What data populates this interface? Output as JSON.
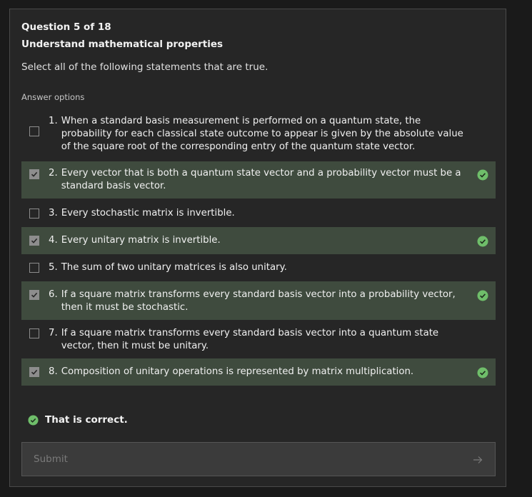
{
  "question": {
    "counter": "Question 5 of 18",
    "title": "Understand mathematical properties",
    "prompt": "Select all of the following statements that are true.",
    "options_label": "Answer options"
  },
  "options": [
    {
      "num": "1.",
      "text": "When a standard basis measurement is performed on a quantum state, the probability for each classical state outcome to appear is given by the absolute value of the square root of the corresponding entry of the quantum state vector.",
      "checked": false,
      "correct_mark": false
    },
    {
      "num": "2.",
      "text": "Every vector that is both a quantum state vector and a probability vector must be a standard basis vector.",
      "checked": true,
      "correct_mark": true
    },
    {
      "num": "3.",
      "text": "Every stochastic matrix is invertible.",
      "checked": false,
      "correct_mark": false
    },
    {
      "num": "4.",
      "text": "Every unitary matrix is invertible.",
      "checked": true,
      "correct_mark": true
    },
    {
      "num": "5.",
      "text": "The sum of two unitary matrices is also unitary.",
      "checked": false,
      "correct_mark": false
    },
    {
      "num": "6.",
      "text": "If a square matrix transforms every standard basis vector into a probability vector, then it must be stochastic.",
      "checked": true,
      "correct_mark": true
    },
    {
      "num": "7.",
      "text": "If a square matrix transforms every standard basis vector into a quantum state vector, then it must be unitary.",
      "checked": false,
      "correct_mark": false
    },
    {
      "num": "8.",
      "text": "Composition of unitary operations is represented by matrix multiplication.",
      "checked": true,
      "correct_mark": true
    }
  ],
  "feedback": {
    "text": "That is correct.",
    "icon": "check-circle-icon"
  },
  "submit": {
    "label": "Submit",
    "icon": "arrow-right-icon"
  },
  "colors": {
    "background": "#1a1a1a",
    "card": "#262626",
    "selected_row": "#3f4b3e",
    "success": "#6fbe6a",
    "submit_bg": "#3b3b3b"
  }
}
